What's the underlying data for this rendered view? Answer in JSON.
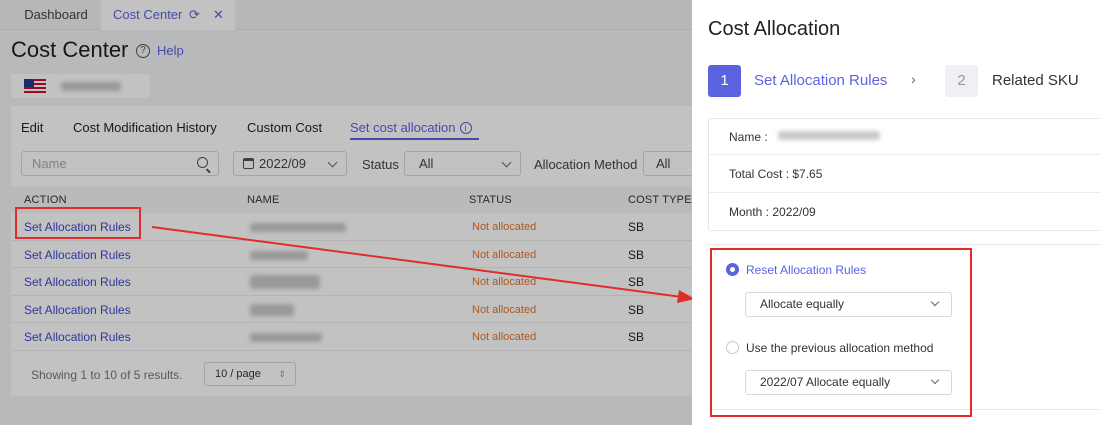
{
  "tabs": [
    {
      "label": "Dashboard"
    },
    {
      "label": "Cost Center"
    }
  ],
  "page": {
    "title": "Cost Center",
    "help_label": "Help"
  },
  "subtabs": [
    {
      "label": "Edit"
    },
    {
      "label": "Cost Modification History"
    },
    {
      "label": "Custom Cost"
    },
    {
      "label": "Set cost allocation"
    }
  ],
  "filters": {
    "name_placeholder": "Name",
    "month_value": "2022/09",
    "status_label": "Status",
    "status_value": "All",
    "method_label": "Allocation Method",
    "method_value": "All"
  },
  "table": {
    "columns": [
      "ACTION",
      "NAME",
      "STATUS",
      "COST TYPE"
    ],
    "rows": [
      {
        "action": "Set Allocation Rules",
        "status": "Not allocated",
        "cost_type": "SB"
      },
      {
        "action": "Set Allocation Rules",
        "status": "Not allocated",
        "cost_type": "SB"
      },
      {
        "action": "Set Allocation Rules",
        "status": "Not allocated",
        "cost_type": "SB"
      },
      {
        "action": "Set Allocation Rules",
        "status": "Not allocated",
        "cost_type": "SB"
      },
      {
        "action": "Set Allocation Rules",
        "status": "Not allocated",
        "cost_type": "SB"
      }
    ]
  },
  "pagination": {
    "summary": "Showing 1 to 10 of 5 results.",
    "page_size": "10 / page"
  },
  "drawer": {
    "title": "Cost Allocation",
    "steps": [
      {
        "number": "1",
        "label": "Set Allocation Rules"
      },
      {
        "number": "2",
        "label": "Related SKU"
      }
    ],
    "step_separator": "›",
    "name_label": "Name :",
    "total_cost": "Total Cost : $7.65",
    "month": "Month : 2022/09",
    "options": [
      {
        "label": "Reset Allocation Rules",
        "selected": true,
        "dropdown": "Allocate equally"
      },
      {
        "label": "Use the previous allocation method",
        "selected": false,
        "dropdown": "2022/07 Allocate equally"
      }
    ]
  },
  "colors": {
    "accent": "#5b63e0",
    "link": "#3e48cf",
    "status_warning": "#e8742a",
    "annotation": "#e22b2b"
  },
  "icons": [
    "refresh-icon",
    "close-icon",
    "help-icon",
    "flag-icon",
    "info-icon",
    "search-icon",
    "calendar-icon",
    "chevron-down-icon"
  ]
}
